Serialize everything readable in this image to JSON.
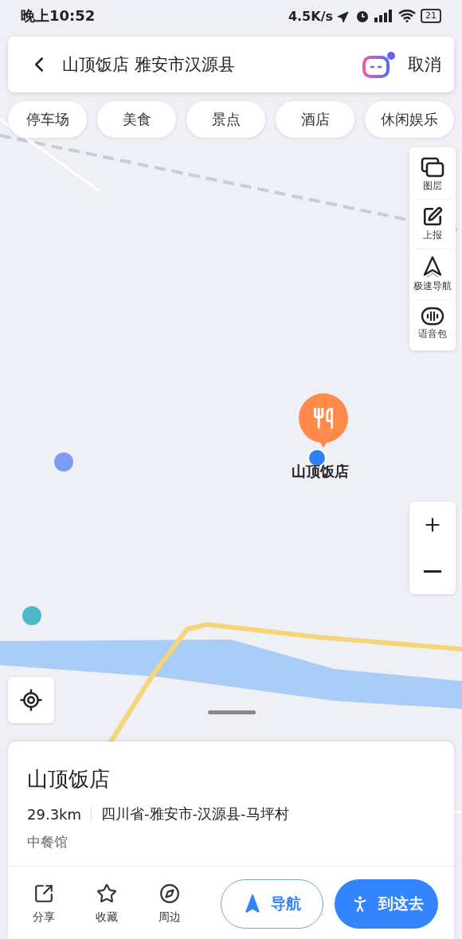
{
  "status_bar": {
    "time": "晚上10:52",
    "network_speed": "4.5K/s",
    "battery": "21"
  },
  "search": {
    "query": "山顶饭店 雅安市汉源县",
    "cancel": "取消"
  },
  "categories": [
    "停车场",
    "美食",
    "景点",
    "酒店",
    "休闲娱乐"
  ],
  "map_tools": [
    {
      "kind": "layers",
      "label": "图层"
    },
    {
      "kind": "report",
      "label": "上报"
    },
    {
      "kind": "fast_nav",
      "label": "极速导航"
    },
    {
      "kind": "voice",
      "label": "语音包"
    }
  ],
  "result_marker": {
    "label": "山顶饭店"
  },
  "place": {
    "name": "山顶饭店",
    "distance": "29.3km",
    "address": "四川省-雅安市-汉源县-马坪村",
    "category": "中餐馆"
  },
  "actions": [
    {
      "kind": "share",
      "label": "分享"
    },
    {
      "kind": "favorite",
      "label": "收藏"
    },
    {
      "kind": "nearby",
      "label": "周边"
    }
  ],
  "buttons": [
    {
      "kind": "navigate",
      "label": "导航"
    },
    {
      "kind": "go_here",
      "label": "到这去"
    }
  ]
}
